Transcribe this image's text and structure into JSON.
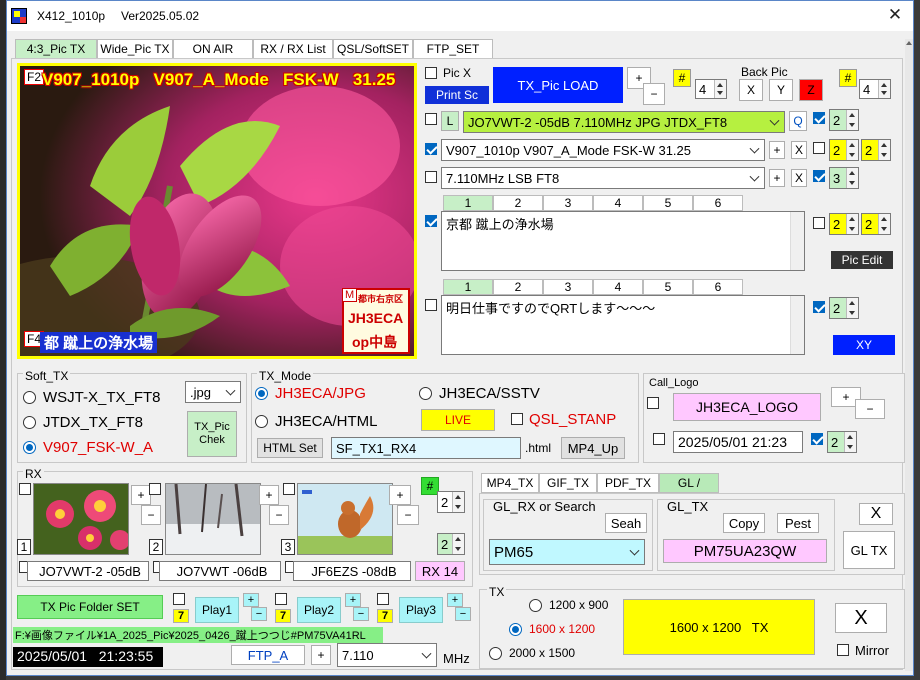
{
  "window": {
    "title": "X412_1010p",
    "version": "Ver2025.05.02"
  },
  "tabs": [
    "4:3_Pic TX",
    "Wide_Pic TX",
    "ON AIR",
    "RX / RX List",
    "QSL/SoftSET",
    "FTP_SET"
  ],
  "preview": {
    "f2": "F2",
    "f4": "F4",
    "overlay_top": "V907_1010p   V907_A_Mode   FSK-W   31.25",
    "overlay_bottom": "都 蹴上の浄水場",
    "stamp_m": "M",
    "stamp_top": "都市右京区",
    "stamp_call": "JH3ECA",
    "stamp_op": "op中島"
  },
  "picx": {
    "label": "Pic X",
    "print": "Print Sc",
    "load": "TX_Pic  LOAD",
    "plus": "+",
    "minus": "−",
    "hash": "#",
    "spin": "4"
  },
  "backpic": {
    "label": "Back Pic",
    "x": "X",
    "y": "Y",
    "z": "Z",
    "hash": "#",
    "spin": "4"
  },
  "lines": {
    "l_btn": "L",
    "line1": "JO7VWT-2 -05dB  7.110MHz  JPG  JTDX_FT8",
    "q": "Q",
    "line2": "V907_1010p  V907_A_Mode  FSK-W  31.25",
    "line3": "7.110MHz  LSB  FT8",
    "plus": "+",
    "x": "X",
    "s1": "2",
    "s2": "2",
    "s2b": "2",
    "s3": "3",
    "s4": "2",
    "s4b": "2",
    "s5": "2"
  },
  "text_tabs": [
    "1",
    "2",
    "3",
    "4",
    "5",
    "6"
  ],
  "text1": "京都 蹴上の浄水場",
  "text2": "明日仕事ですのでQRTします〜〜〜",
  "pic_edit": "Pic  Edit",
  "xy": "XY",
  "soft_tx": {
    "label": "Soft_TX",
    "items": [
      "WSJT-X_TX_FT8",
      "JTDX_TX_FT8",
      "V907_FSK-W_A"
    ],
    "ext": ".jpg",
    "chek": "TX_Pic Chek"
  },
  "tx_mode": {
    "label": "TX_Mode",
    "jpg": "JH3ECA/JPG",
    "sstv": "JH3ECA/SSTV",
    "html": "JH3ECA/HTML",
    "live": "LIVE",
    "stanp": "QSL_STANP",
    "html_set": "HTML Set",
    "file": "SF_TX1_RX4",
    "html_ext": ".html",
    "mp4": "MP4_Up"
  },
  "call_logo": {
    "label": "Call_Logo",
    "logo": "JH3ECA_LOGO",
    "plus": "+",
    "minus": "−",
    "date": "2025/05/01  21:23",
    "spin": "2"
  },
  "rx": {
    "label": "RX",
    "hash": "#",
    "spin1": "2",
    "spin2": "2",
    "rx14": "RX 14",
    "thumbs": [
      {
        "n": "1",
        "call": "JO7VWT-2  -05dB"
      },
      {
        "n": "2",
        "call": "JO7VWT  -06dB"
      },
      {
        "n": "3",
        "call": "JF6EZS  -08dB"
      }
    ],
    "folder": "TX Pic  Folder SET",
    "plays": [
      "Play1",
      "Play2",
      "Play3"
    ],
    "seven": "7",
    "path": "F:¥画像ファイル¥1A_2025_Pic¥2025_0426_蹴上つつじ#PM75VA41RL",
    "datetime": "2025/05/01   21:23:55",
    "ftp": "FTP_A",
    "plus": "+",
    "freq": "7.110",
    "mhz": "MHz"
  },
  "gl": {
    "tabs": [
      "MP4_TX",
      "GIF_TX",
      "PDF_TX",
      "GL /"
    ],
    "rx_label": "GL_RX or Search",
    "seah": "Seah",
    "grid": "PM65",
    "tx_label": "GL_TX",
    "copy": "Copy",
    "pest": "Pest",
    "tx_grid": "PM75UA23QW",
    "x": "X",
    "gltx": "GL TX"
  },
  "tx": {
    "label": "TX",
    "sizes": [
      "1200 x 900",
      "1600 x 1200",
      "2000 x 1500"
    ],
    "big": "1600 x 1200   TX",
    "x": "X",
    "mirror": "Mirror"
  }
}
